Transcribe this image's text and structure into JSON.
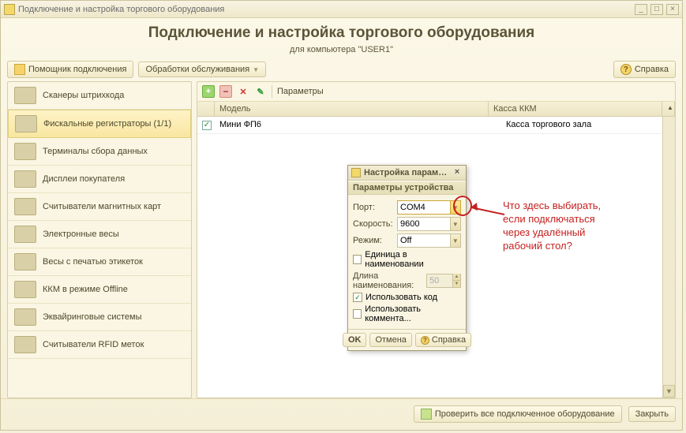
{
  "window": {
    "title": "Подключение и настройка торгового оборудования",
    "header_main": "Подключение и настройка торгового оборудования",
    "header_sub": "для компьютера \"USER1\""
  },
  "toolbar": {
    "wizard_label": "Помощник подключения",
    "service_label": "Обработки обслуживания",
    "help_label": "Справка"
  },
  "sidebar": {
    "items": [
      {
        "label": "Сканеры штрихкода"
      },
      {
        "label": "Фискальные регистраторы (1/1)"
      },
      {
        "label": "Терминалы сбора данных"
      },
      {
        "label": "Дисплеи покупателя"
      },
      {
        "label": "Считыватели магнитных карт"
      },
      {
        "label": "Электронные весы"
      },
      {
        "label": "Весы с печатью этикеток"
      },
      {
        "label": "ККМ в режиме Offline"
      },
      {
        "label": "Эквайринговые системы"
      },
      {
        "label": "Считыватели RFID меток"
      }
    ]
  },
  "content": {
    "params_label": "Параметры",
    "columns": {
      "model": "Модель",
      "kassa": "Касса ККМ"
    },
    "rows": [
      {
        "checked": true,
        "model": "Мини ФП6",
        "kassa": "Касса торгового зала"
      }
    ]
  },
  "footer": {
    "check_all_label": "Проверить все подключенное оборудование",
    "close_label": "Закрыть"
  },
  "dialog": {
    "title": "Настройка парамет...",
    "section": "Параметры устройства",
    "port_label": "Порт:",
    "port_value": "COM4",
    "speed_label": "Скорость:",
    "speed_value": "9600",
    "mode_label": "Режим:",
    "mode_value": "Off",
    "unit_in_name_label": "Единица в наименовании",
    "unit_in_name_checked": false,
    "name_length_label": "Длина наименования:",
    "name_length_value": "50",
    "use_code_label": "Использовать код",
    "use_code_checked": true,
    "use_comment_label": "Использовать коммента...",
    "use_comment_checked": false,
    "ok_label": "OK",
    "cancel_label": "Отмена",
    "help_label": "Справка"
  },
  "annotation": {
    "line1": "Что здесь выбирать,",
    "line2": "если подключаться",
    "line3": "через удалённый",
    "line4": "рабочий стол?"
  }
}
